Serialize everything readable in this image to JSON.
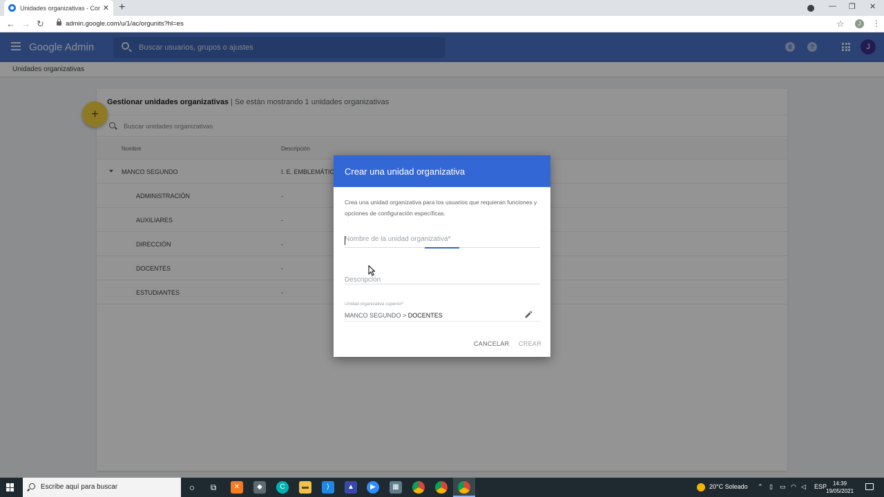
{
  "browser": {
    "tab_title": "Unidades organizativas - Consola",
    "tab_close": "✕",
    "new_tab": "+",
    "url": "admin.google.com/u/1/ac/orgunits?hl=es",
    "profile_initial": "J",
    "window_controls": [
      "—",
      "❐",
      "✕"
    ]
  },
  "appbar": {
    "brand": "Google Admin",
    "search_placeholder": "Buscar usuarios, grupos o ajustes",
    "notifications_count": "8",
    "help": "?",
    "avatar_initial": "J"
  },
  "breadcrumb": "Unidades organizativas",
  "card": {
    "title": "Gestionar unidades organizativas",
    "subtitle": " | Se están mostrando 1 unidades organizativas",
    "search_placeholder": "Buscar unidades organizativas",
    "columns": [
      "Nombre",
      "Descripción"
    ],
    "rows": [
      {
        "name": "MANCO SEGUNDO",
        "description": "I. E. EMBLEMÁTICO",
        "level": 0
      },
      {
        "name": "ADMINISTRACIÓN",
        "description": "-",
        "level": 1
      },
      {
        "name": "AUXILIARES",
        "description": "-",
        "level": 1
      },
      {
        "name": "DIRECCIÓN",
        "description": "-",
        "level": 1
      },
      {
        "name": "DOCENTES",
        "description": "-",
        "level": 1
      },
      {
        "name": "ESTUDIANTES",
        "description": "-",
        "level": 1
      }
    ],
    "fab_label": "+"
  },
  "dialog": {
    "title": "Crear una unidad organizativa",
    "description": "Crea una unidad organizativa para los usuarios que requieran funciones y opciones de configuración específicas.",
    "name_placeholder": "Nombre de la unidad organizativa*",
    "description_placeholder": "Descripción",
    "parent_label": "Unidad organizativa superior*",
    "parent_path": "MANCO SEGUNDO > ",
    "parent_current": "DOCENTES",
    "cancel": "CANCELAR",
    "create": "CREAR"
  },
  "taskbar": {
    "search_text": "Escribe aquí para buscar",
    "weather": "20°C  Soleado",
    "language": "ESP",
    "time": "14:39",
    "date": "19/05/2021"
  },
  "colors": {
    "appbar": "#4a74c9",
    "dialog_header": "#3367d6",
    "fab": "#f4d13f"
  }
}
